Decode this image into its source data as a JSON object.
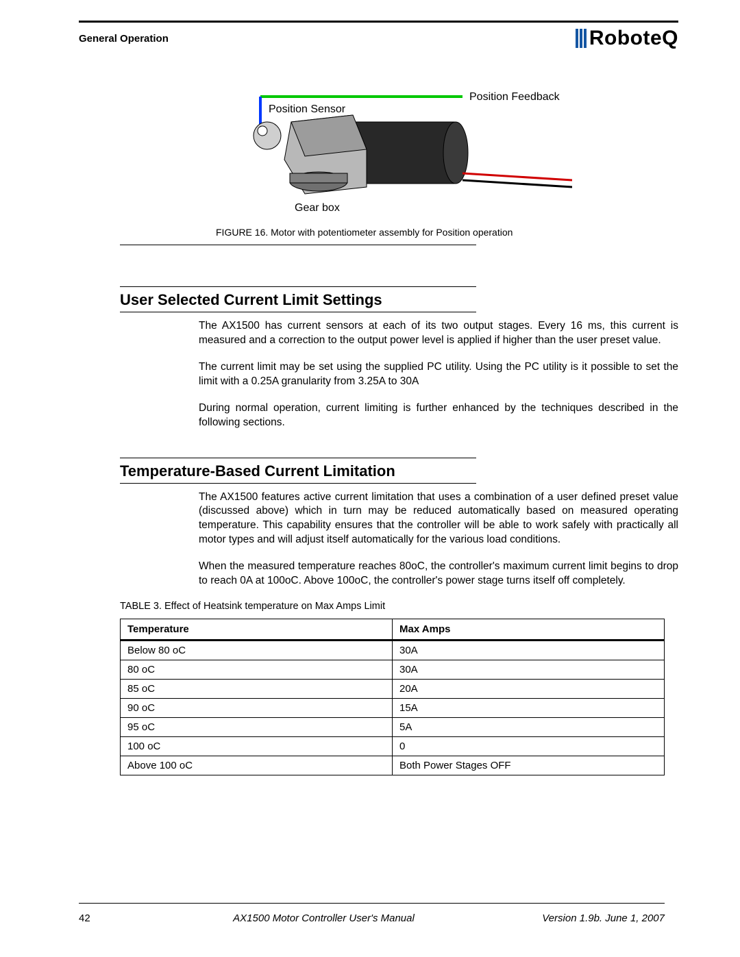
{
  "header": {
    "section_label": "General Operation",
    "brand": "RoboteQ"
  },
  "figure": {
    "label_position_sensor": "Position Sensor",
    "label_position_feedback": "Position Feedback",
    "label_gearbox": "Gear box",
    "caption": "FIGURE 16.  Motor with potentiometer assembly for Position operation"
  },
  "section1": {
    "title": "User Selected Current Limit Settings",
    "p1": "The AX1500 has current sensors at each of its two output stages. Every 16 ms, this current is measured and a correction to the output power level is applied if higher than the user preset value.",
    "p2": "The current limit may be set using the supplied PC utility. Using the PC utility is it possible to set the limit with a 0.25A granularity from 3.25A to 30A",
    "p3": "During normal operation, current limiting is further enhanced by the techniques described in the following sections."
  },
  "section2": {
    "title": "Temperature-Based Current Limitation",
    "p1": "The AX1500 features active current limitation that uses a combination of a user defined preset value (discussed above) which in turn may be reduced automatically based on measured operating temperature. This capability ensures that the controller will be able to work safely with practically all motor types and will adjust itself automatically for the various load conditions.",
    "p2": "When the measured temperature reaches 80oC, the controller's maximum current limit begins to drop to reach 0A at 100oC. Above 100oC, the controller's power stage turns itself off completely."
  },
  "table": {
    "caption": "TABLE 3. Effect of Heatsink temperature on Max Amps Limit",
    "col1": "Temperature",
    "col2": "Max Amps",
    "rows": [
      {
        "temp": "Below 80 oC",
        "amps": "30A"
      },
      {
        "temp": "80 oC",
        "amps": "30A"
      },
      {
        "temp": "85 oC",
        "amps": "20A"
      },
      {
        "temp": "90 oC",
        "amps": "15A"
      },
      {
        "temp": "95 oC",
        "amps": "5A"
      },
      {
        "temp": "100 oC",
        "amps": "0"
      },
      {
        "temp": "Above 100 oC",
        "amps": "Both Power Stages OFF"
      }
    ]
  },
  "footer": {
    "page": "42",
    "title": "AX1500 Motor Controller User's Manual",
    "version": "Version 1.9b. June 1, 2007"
  },
  "chart_data": {
    "type": "table",
    "title": "Effect of Heatsink temperature on Max Amps Limit",
    "columns": [
      "Temperature",
      "Max Amps"
    ],
    "rows": [
      [
        "Below 80 oC",
        "30A"
      ],
      [
        "80 oC",
        "30A"
      ],
      [
        "85 oC",
        "20A"
      ],
      [
        "90 oC",
        "15A"
      ],
      [
        "95 oC",
        "5A"
      ],
      [
        "100 oC",
        "0"
      ],
      [
        "Above 100 oC",
        "Both Power Stages OFF"
      ]
    ]
  }
}
